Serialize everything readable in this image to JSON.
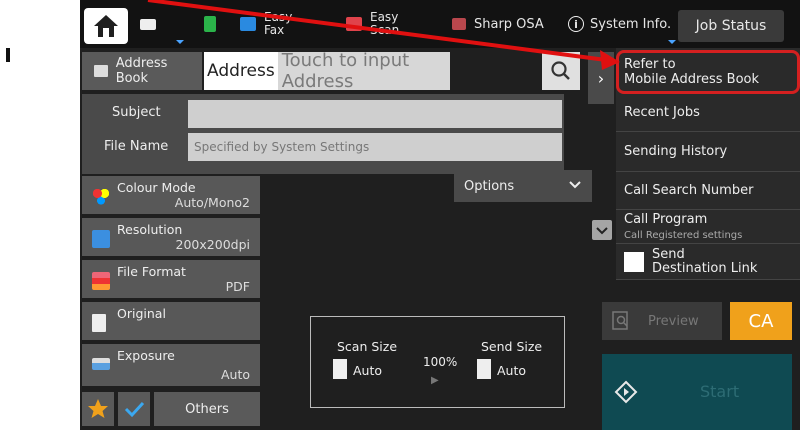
{
  "topbar": {
    "tab1": "Easy\nFax",
    "tab2_l1": "Easy",
    "tab2_l2": "Scan",
    "easyfax_l1": "Easy",
    "easyfax_l2": "Fax",
    "sharp_osa": "Sharp OSA",
    "system_info": "System Info.",
    "job_status": "Job Status"
  },
  "address": {
    "book_label": "Address Book",
    "field_label": "Address",
    "placeholder": "Touch to input Address"
  },
  "form": {
    "subject_label": "Subject",
    "file_name_label": "File Name",
    "file_name_value": "Specified by System Settings"
  },
  "settings": [
    {
      "name": "Colour Mode",
      "value": "Auto/Mono2"
    },
    {
      "name": "Resolution",
      "value": "200x200dpi"
    },
    {
      "name": "File Format",
      "value": "PDF"
    },
    {
      "name": "Original",
      "value": ""
    },
    {
      "name": "Exposure",
      "value": "Auto"
    }
  ],
  "options_label": "Options",
  "sizes": {
    "scan_label": "Scan Size",
    "scan_value": "Auto",
    "ratio": "100%",
    "send_label": "Send Size",
    "send_value": "Auto"
  },
  "others_label": "Others",
  "menu": {
    "refer_l1": "Refer to",
    "refer_l2": "Mobile Address Book",
    "recent_jobs": "Recent Jobs",
    "sending_history": "Sending History",
    "call_search": "Call Search Number",
    "call_program": "Call Program",
    "call_program_sub": "Call Registered settings",
    "send_l1": "Send",
    "send_l2": "Destination Link"
  },
  "preview_label": "Preview",
  "ca_label": "CA",
  "start_label": "Start",
  "colors": {
    "accent": "#f0a11b",
    "highlight": "#d42020",
    "start_bg": "#0f4a52"
  }
}
